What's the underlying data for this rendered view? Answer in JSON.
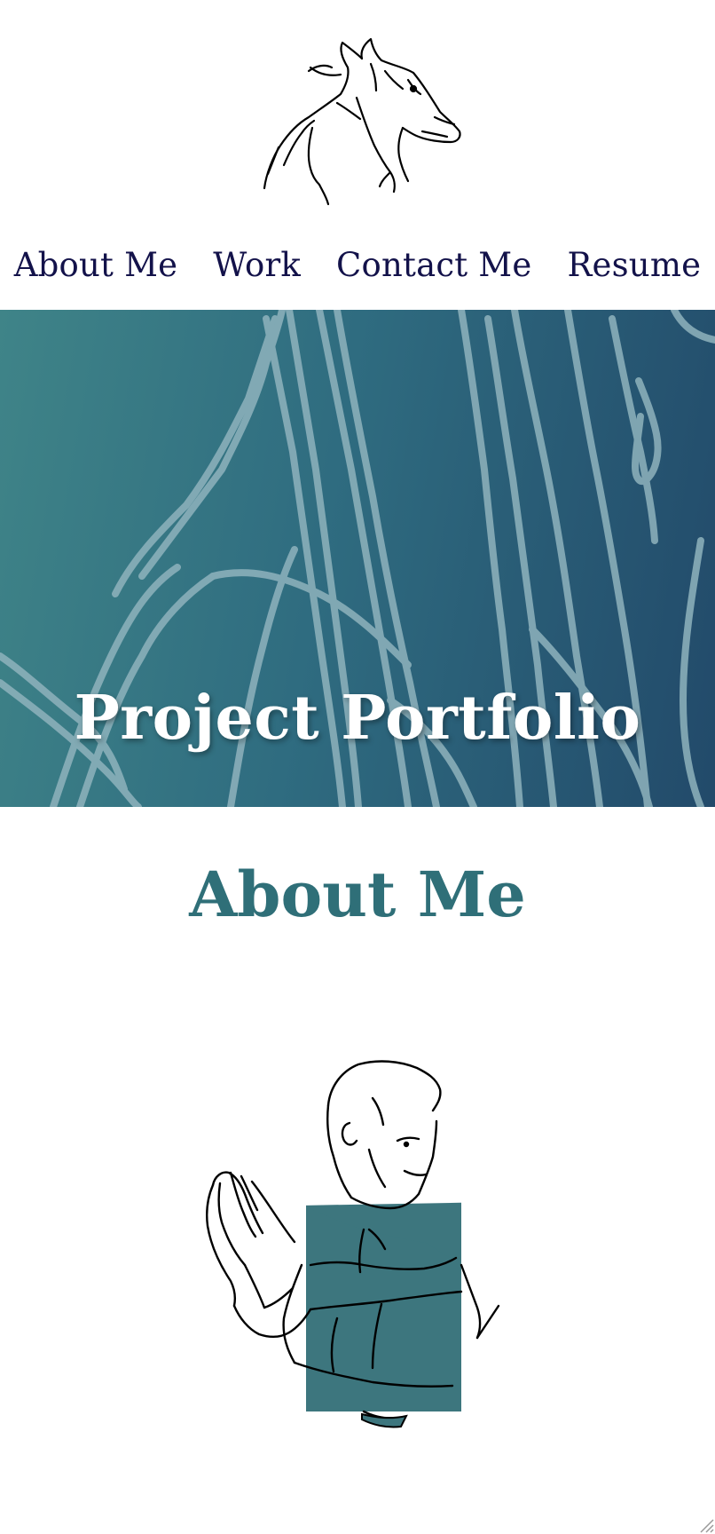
{
  "brand": {
    "logo_icon": "horse-sketch-icon"
  },
  "nav": {
    "items": [
      {
        "label": "About Me"
      },
      {
        "label": "Work"
      },
      {
        "label": "Contact Me"
      },
      {
        "label": "Resume"
      }
    ]
  },
  "hero": {
    "title": "Project Portfolio",
    "background_colors": [
      "#3f8488",
      "#224a6a"
    ],
    "pattern": "sketch-lines"
  },
  "about": {
    "title": "About Me",
    "illustration": "praying-man-sketch-icon"
  },
  "colors": {
    "nav_text": "#13124a",
    "accent": "#2f6f78",
    "hero_text": "#ffffff"
  }
}
